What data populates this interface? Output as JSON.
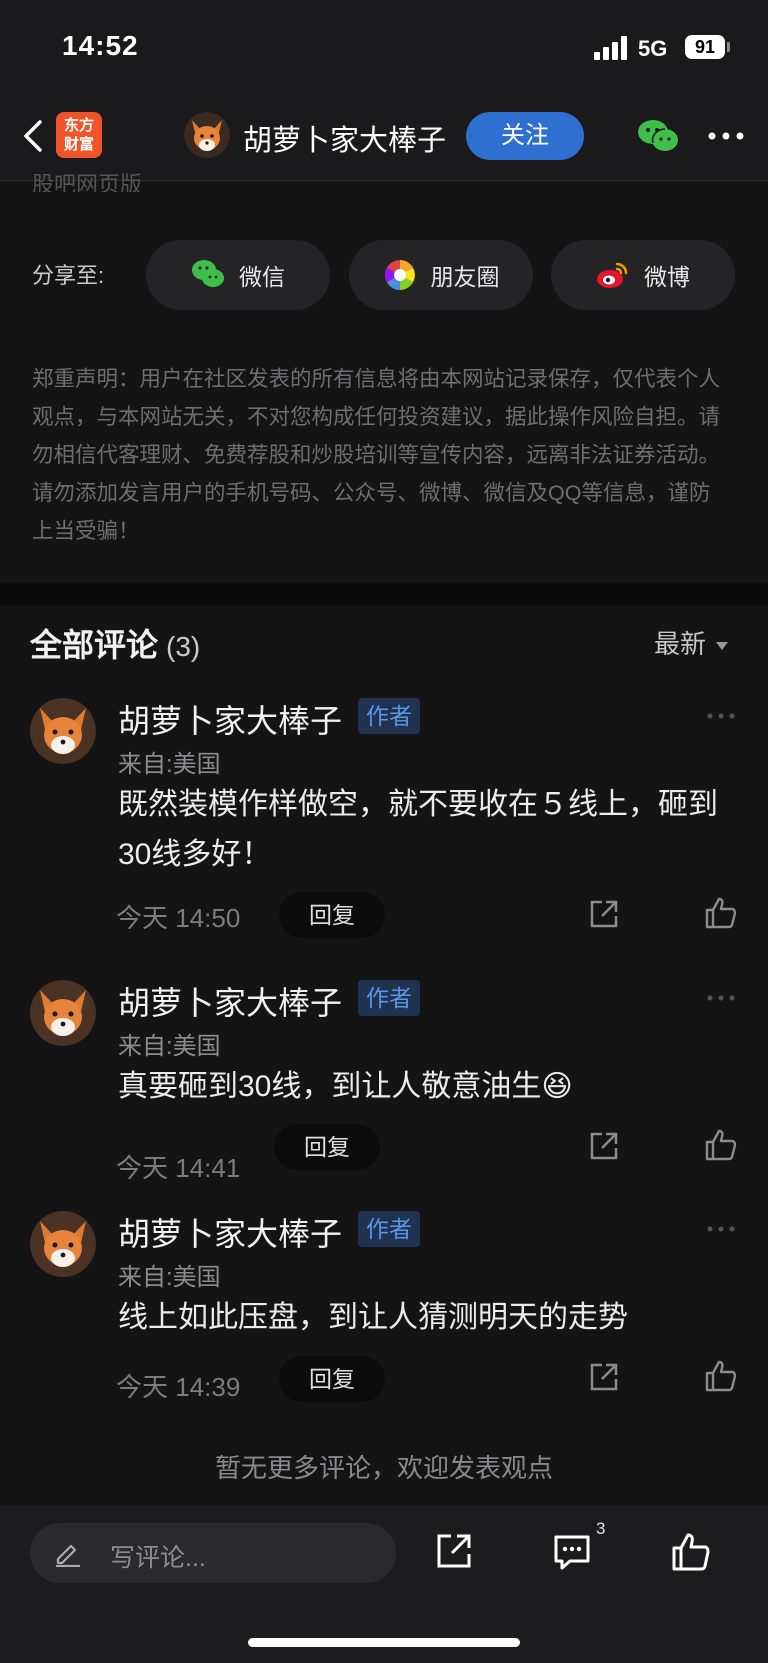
{
  "status": {
    "time": "14:52",
    "network": "5G",
    "battery": "91"
  },
  "nav": {
    "logo_line1": "东方",
    "logo_line2": "财富",
    "author_name": "胡萝卜家大棒子",
    "follow_label": "关注"
  },
  "partial_text": "股吧网页版",
  "share": {
    "label": "分享至:",
    "options": [
      "微信",
      "朋友圈",
      "微博"
    ]
  },
  "disclaimer": "郑重声明：用户在社区发表的所有信息将由本网站记录保存，仅代表个人观点，与本网站无关，不对您构成任何投资建议，据此操作风险自担。请勿相信代客理财、免费荐股和炒股培训等宣传内容，远离非法证券活动。请勿添加发言用户的手机号码、公众号、微博、微信及QQ等信息，谨防上当受骗！",
  "comments_header": {
    "title": "全部评论",
    "count": "(3)",
    "sort": "最新"
  },
  "comments": [
    {
      "name": "胡萝卜家大棒子",
      "badge": "作者",
      "from": "来自:美国",
      "text": "既然装模作样做空，就不要收在５线上，砸到30线多好！",
      "time": "今天 14:50",
      "reply": "回复"
    },
    {
      "name": "胡萝卜家大棒子",
      "badge": "作者",
      "from": "来自:美国",
      "text": "真要砸到30线，到让人敬意油生",
      "emoji": "😆",
      "time": "今天 14:41",
      "reply": "回复"
    },
    {
      "name": "胡萝卜家大棒子",
      "badge": "作者",
      "from": "来自:美国",
      "text": "线上如此压盘，到让人猜测明天的走势",
      "time": "今天 14:39",
      "reply": "回复"
    }
  ],
  "no_more": "暂无更多评论，欢迎发表观点",
  "bottom": {
    "placeholder": "写评论...",
    "comment_count": "3"
  },
  "colors": {
    "accent_blue": "#2f6fd0",
    "logo_orange": "#f0552a",
    "background": "#141414"
  },
  "icons": [
    "back-icon",
    "wechat-icon",
    "more-icon",
    "moments-icon",
    "weibo-icon",
    "share-icon",
    "like-icon",
    "pencil-icon",
    "comment-icon"
  ]
}
